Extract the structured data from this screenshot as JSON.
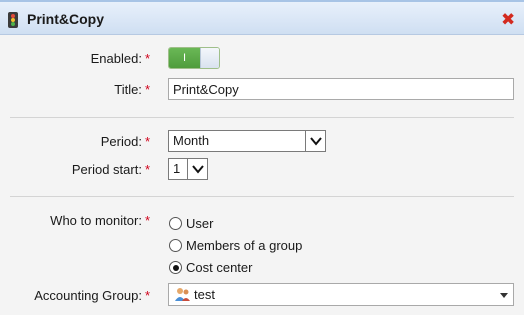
{
  "window": {
    "title": "Print&Copy",
    "icon": "traffic-light-icon",
    "close_icon": "close-icon"
  },
  "colors": {
    "accent_green": "#5aa845",
    "required": "#d0021b",
    "close": "#d32a1f"
  },
  "form": {
    "enabled": {
      "label": "Enabled:",
      "state_text": "I",
      "value": true
    },
    "title": {
      "label": "Title:",
      "value": "Print&Copy"
    },
    "period": {
      "label": "Period:",
      "value": "Month"
    },
    "period_start": {
      "label": "Period start:",
      "value": "1"
    },
    "who_to_monitor": {
      "label": "Who to monitor:",
      "options": [
        {
          "label": "User",
          "checked": false
        },
        {
          "label": "Members of a group",
          "checked": false
        },
        {
          "label": "Cost center",
          "checked": true
        }
      ]
    },
    "accounting_group": {
      "label": "Accounting Group:",
      "value": "test",
      "icon": "group-icon"
    },
    "required_mark": "*"
  }
}
